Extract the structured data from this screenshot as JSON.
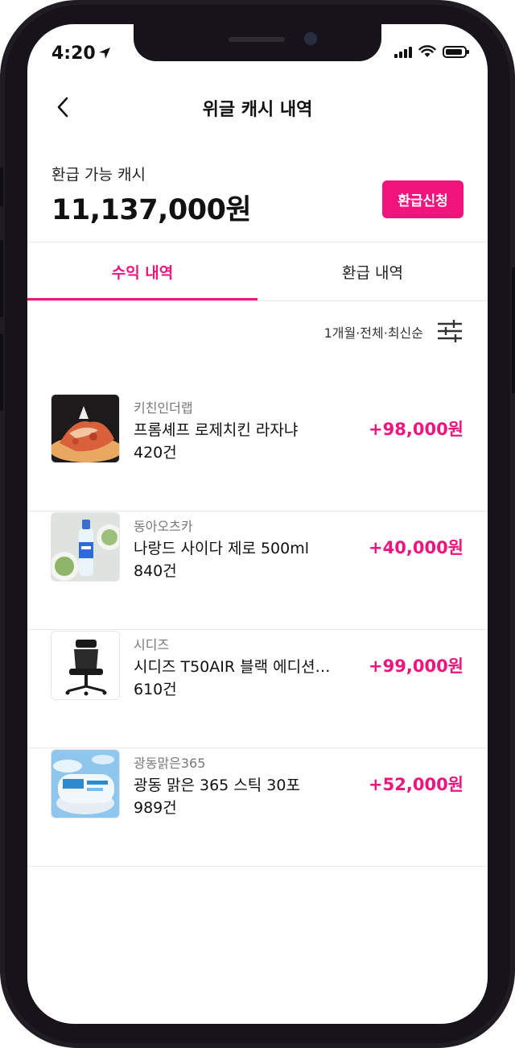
{
  "status_bar": {
    "time": "4:20"
  },
  "header": {
    "title": "위글 캐시 내역"
  },
  "cash": {
    "label": "환급 가능 캐시",
    "amount": "11,137,000원",
    "refund_button": "환급신청"
  },
  "tabs": [
    {
      "label": "수익 내역",
      "active": true
    },
    {
      "label": "환급 내역",
      "active": false
    }
  ],
  "filter": {
    "summary": "1개월·전체·최신순"
  },
  "items": [
    {
      "brand": "키친인더랩",
      "name": "프롬셰프 로제치킨 라자냐",
      "count": "420건",
      "amount": "+98,000원",
      "thumb": "lasagna"
    },
    {
      "brand": "동아오츠카",
      "name": "나랑드 사이다 제로 500ml",
      "count": "840건",
      "amount": "+40,000원",
      "thumb": "soda-bottle"
    },
    {
      "brand": "시디즈",
      "name": "시디즈 T50AIR 블랙 에디션…",
      "count": "610건",
      "amount": "+99,000원",
      "thumb": "office-chair"
    },
    {
      "brand": "광동맑은365",
      "name": "광동 맑은 365 스틱 30포",
      "count": "989건",
      "amount": "+52,000원",
      "thumb": "supplement-box"
    }
  ],
  "colors": {
    "accent": "#f0147c",
    "frame": "#1f1c24"
  }
}
